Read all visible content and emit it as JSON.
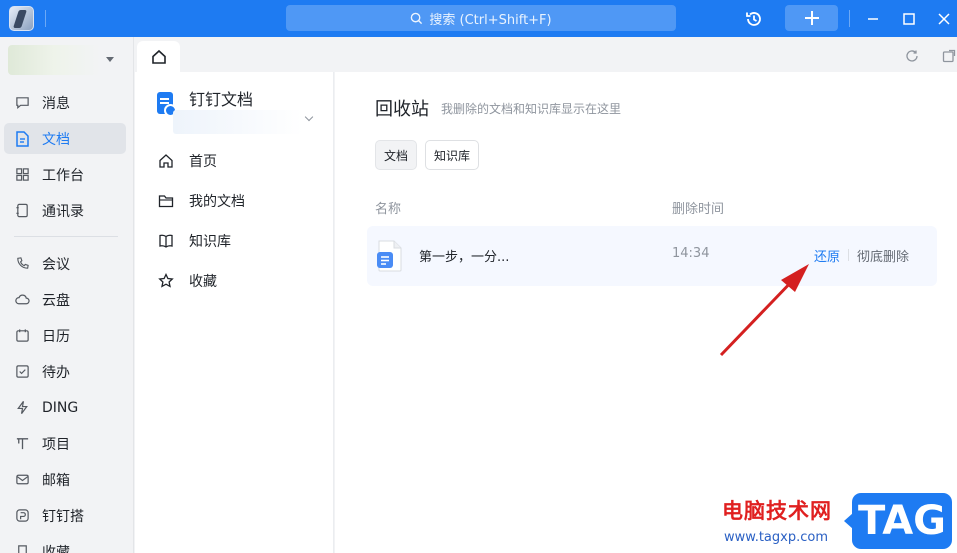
{
  "titlebar": {
    "search_placeholder": "搜索 (Ctrl+Shift+F)"
  },
  "sidebar": {
    "items": [
      {
        "label": "消息",
        "icon": "message-icon"
      },
      {
        "label": "文档",
        "icon": "document-icon",
        "active": true
      },
      {
        "label": "工作台",
        "icon": "workbench-icon"
      },
      {
        "label": "通讯录",
        "icon": "contacts-icon"
      },
      {
        "label": "会议",
        "icon": "meeting-icon"
      },
      {
        "label": "云盘",
        "icon": "cloud-drive-icon"
      },
      {
        "label": "日历",
        "icon": "calendar-icon"
      },
      {
        "label": "待办",
        "icon": "todo-icon"
      },
      {
        "label": "DING",
        "icon": "ding-icon"
      },
      {
        "label": "项目",
        "icon": "project-icon"
      },
      {
        "label": "邮箱",
        "icon": "mail-icon"
      },
      {
        "label": "钉钉搭",
        "icon": "dingda-icon"
      },
      {
        "label": "收藏",
        "icon": "favorites-icon"
      }
    ]
  },
  "docnav": {
    "title": "钉钉文档",
    "items": [
      {
        "label": "首页",
        "icon": "home-icon"
      },
      {
        "label": "我的文档",
        "icon": "folder-icon"
      },
      {
        "label": "知识库",
        "icon": "book-icon"
      },
      {
        "label": "收藏",
        "icon": "star-icon"
      }
    ]
  },
  "main": {
    "title": "回收站",
    "description": "我删除的文档和知识库显示在这里",
    "filters": [
      "文档",
      "知识库"
    ],
    "columns": {
      "name": "名称",
      "deleted_time": "删除时间"
    },
    "rows": [
      {
        "name": "第一步，一分...",
        "deleted_time": "14:34",
        "restore": "还原",
        "delete": "彻底删除"
      }
    ]
  },
  "watermark": {
    "text": "电脑技术网",
    "url": "www.tagxp.com",
    "badge": "TAG"
  },
  "colors": {
    "accent": "#1e7bf2",
    "annotation_arrow": "#d42020"
  }
}
